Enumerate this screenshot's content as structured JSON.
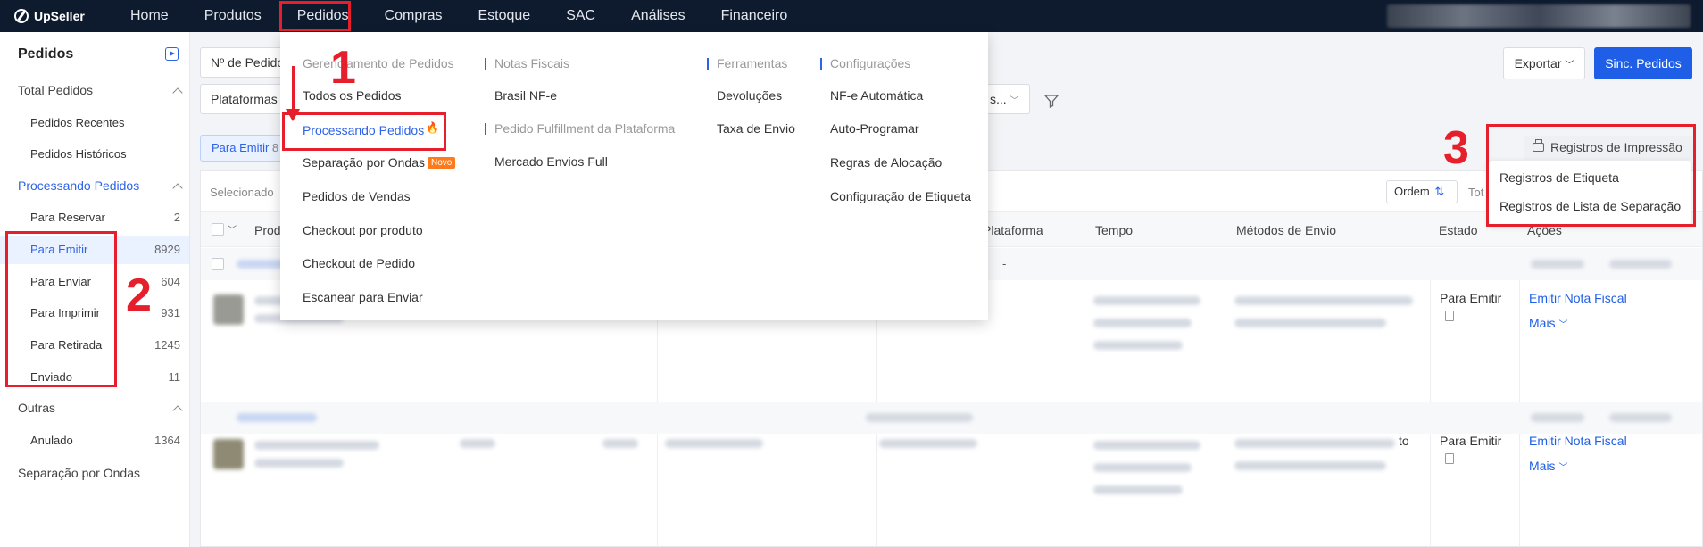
{
  "app": {
    "logo_text": "UpSeller"
  },
  "topnav": {
    "items": [
      "Home",
      "Produtos",
      "Pedidos",
      "Compras",
      "Estoque",
      "SAC",
      "Análises",
      "Financeiro"
    ],
    "active": "Pedidos"
  },
  "sidebar": {
    "title": "Pedidos",
    "groups": {
      "total": "Total Pedidos",
      "processando": "Processando Pedidos",
      "outras": "Outras",
      "separacao": "Separação por Ondas"
    },
    "total_items": [
      {
        "label": "Pedidos Recentes",
        "count": ""
      },
      {
        "label": "Pedidos Históricos",
        "count": ""
      }
    ],
    "processando_items": [
      {
        "label": "Para Reservar",
        "count": "2"
      },
      {
        "label": "Para Emitir",
        "count": "8929"
      },
      {
        "label": "Para Enviar",
        "count": "604"
      },
      {
        "label": "Para Imprimir",
        "count": "931"
      },
      {
        "label": "Para Retirada",
        "count": "1245"
      },
      {
        "label": "Enviado",
        "count": "11"
      }
    ],
    "outras_items": [
      {
        "label": "Anulado",
        "count": "1364"
      }
    ]
  },
  "filters": {
    "order_select": "Nº de Pedido",
    "platform_select": "Plataformas",
    "right_select": "s..."
  },
  "toolbar": {
    "export_label": "Exportar",
    "sync_label": "Sinc. Pedidos",
    "print_records_label": "Registros de Impressão"
  },
  "tab": {
    "label": "Para Emitir",
    "count": "8"
  },
  "table": {
    "selected_label": "Selecionado",
    "order_label": "Ordem",
    "total_label": "Tot",
    "headers": {
      "product": "Prod",
      "platform": "Plataforma",
      "time": "Tempo",
      "shipping": "Métodos de Envio",
      "state": "Estado",
      "actions": "Ações"
    },
    "group_row_text": "-",
    "rows": [
      {
        "state": "Para Emitir",
        "action1": "Emitir Nota Fiscal",
        "action2": "Mais"
      },
      {
        "state": "Para Emitir",
        "action1": "Emitir Nota Fiscal",
        "action2": "Mais",
        "overflow_text": "to"
      }
    ]
  },
  "print_menu": {
    "items": [
      "Registros de Etiqueta",
      "Registros de Lista de Separação"
    ]
  },
  "mega_menu": {
    "col1": {
      "heading": "Gerenciamento de Pedidos",
      "items": [
        "Todos os Pedidos",
        "Processando Pedidos",
        "Separação por Ondas",
        "Pedidos de Vendas",
        "Checkout por produto",
        "Checkout de Pedido",
        "Escanear para Enviar"
      ],
      "novo_badge": "Novo"
    },
    "col2": {
      "heading": "Notas Fiscais",
      "items": [
        "Brasil NF-e"
      ],
      "heading2": "Pedido Fulfillment da Plataforma",
      "items2": [
        "Mercado Envios Full"
      ]
    },
    "col3": {
      "heading": "Ferramentas",
      "items": [
        "Devoluções",
        "Taxa de Envio"
      ]
    },
    "col4": {
      "heading": "Configurações",
      "items": [
        "NF-e Automática",
        "Auto-Programar",
        "Regras de Alocação",
        "Configuração de Etiqueta"
      ]
    }
  },
  "annotations": {
    "n1": "1",
    "n2": "2",
    "n3": "3",
    "color": "#e5202c"
  },
  "colors": {
    "accent": "#2d63e8",
    "nav_bg": "#0e1b2e",
    "primary_button": "#1f5fe8",
    "badge": "#ff7a1a"
  }
}
